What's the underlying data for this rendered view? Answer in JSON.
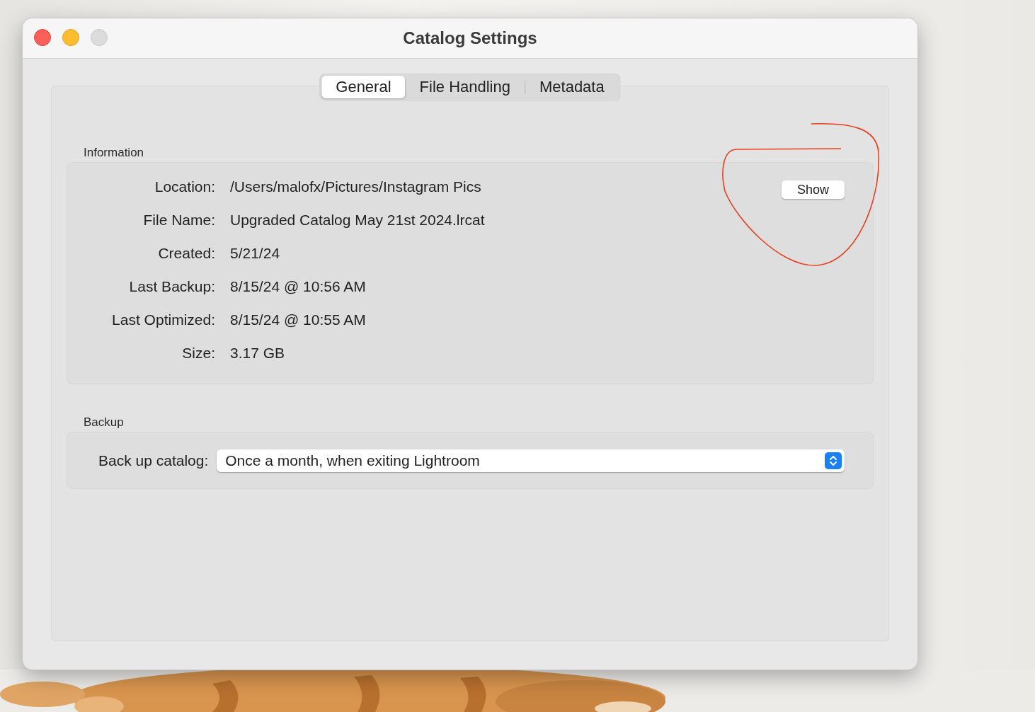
{
  "window": {
    "title": "Catalog Settings"
  },
  "tabs": [
    {
      "label": "General",
      "selected": true
    },
    {
      "label": "File Handling",
      "selected": false
    },
    {
      "label": "Metadata",
      "selected": false
    }
  ],
  "information": {
    "heading": "Information",
    "button": "Show",
    "fields": [
      {
        "label": "Location:",
        "value": "/Users/malofx/Pictures/Instagram Pics"
      },
      {
        "label": "File Name:",
        "value": "Upgraded Catalog May 21st 2024.lrcat"
      },
      {
        "label": "Created:",
        "value": "5/21/24"
      },
      {
        "label": "Last Backup:",
        "value": "8/15/24 @ 10:56 AM"
      },
      {
        "label": "Last Optimized:",
        "value": "8/15/24 @ 10:55 AM"
      },
      {
        "label": "Size:",
        "value": "3.17 GB"
      }
    ]
  },
  "backup": {
    "heading": "Backup",
    "label": "Back up catalog:",
    "value": "Once a month, when exiting Lightroom"
  }
}
